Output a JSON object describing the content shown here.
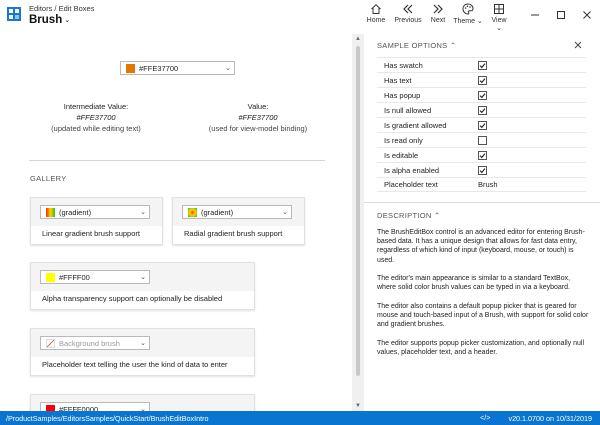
{
  "header": {
    "breadcrumb": "Editors / Edit Boxes",
    "title": "Brush"
  },
  "nav": [
    {
      "label": "Home",
      "icon": "home-icon"
    },
    {
      "label": "Previous",
      "icon": "double-chevron-left-icon"
    },
    {
      "label": "Next",
      "icon": "double-chevron-right-icon"
    },
    {
      "label": "Theme",
      "icon": "palette-icon"
    },
    {
      "label": "View",
      "icon": "view-grid-icon"
    }
  ],
  "main": {
    "top_box": {
      "value": "#FFE37700",
      "swatch": "#e37700"
    },
    "intermediate": {
      "label": "Intermediate Value:",
      "value": "#FFE37700",
      "note": "(updated while editing text)"
    },
    "bound": {
      "label": "Value:",
      "value": "#FFE37700",
      "note": "(used for view-model binding)"
    },
    "gallery_header": "GALLERY",
    "cards": [
      {
        "box_text": "(gradient)",
        "caption": "Linear gradient brush support"
      },
      {
        "box_text": "(gradient)",
        "caption": "Radial gradient brush support"
      },
      {
        "box_text": "#FFFF00",
        "caption": "Alpha transparency support can optionally be disabled",
        "swatch": "#ffff00"
      },
      {
        "box_text": "Background brush",
        "caption": "Placeholder text telling the user the kind of data to enter"
      },
      {
        "box_text": "#FFFF0000",
        "swatch": "#ff0000"
      }
    ]
  },
  "options": {
    "header": "SAMPLE OPTIONS",
    "rows": [
      {
        "name": "Has swatch",
        "checked": true
      },
      {
        "name": "Has text",
        "checked": true
      },
      {
        "name": "Has popup",
        "checked": true
      },
      {
        "name": "Is null allowed",
        "checked": true
      },
      {
        "name": "Is gradient allowed",
        "checked": true
      },
      {
        "name": "Is read only",
        "checked": false
      },
      {
        "name": "Is editable",
        "checked": true
      },
      {
        "name": "Is alpha enabled",
        "checked": true
      }
    ],
    "placeholder": {
      "name": "Placeholder text",
      "value": "Brush"
    }
  },
  "description": {
    "header": "DESCRIPTION",
    "paragraphs": [
      "The BrushEditBox control is an advanced editor for entering Brush-based data. It has a unique design that allows for fast data entry, regardless of which kind of input (keyboard, mouse, or touch) is used.",
      "The editor's main appearance is similar to a standard TextBox, where solid color brush values can be typed in via a keyboard.",
      "The editor also contains a default popup picker that is geared for mouse and touch-based input of a Brush, with support for solid color and gradient brushes.",
      "The editor supports popup picker customization, and optionally null values, placeholder text, and a header."
    ]
  },
  "status": {
    "path": "/ProductSamples/EditorsSamples/QuickStart/BrushEditBoxIntro",
    "code_icon": "</>",
    "version": "v20.1.0700 on 10/31/2019"
  },
  "colors": {
    "accent": "#0a75d1",
    "orange": "#e37700",
    "yellow": "#ffff00",
    "red": "#ff0000"
  }
}
